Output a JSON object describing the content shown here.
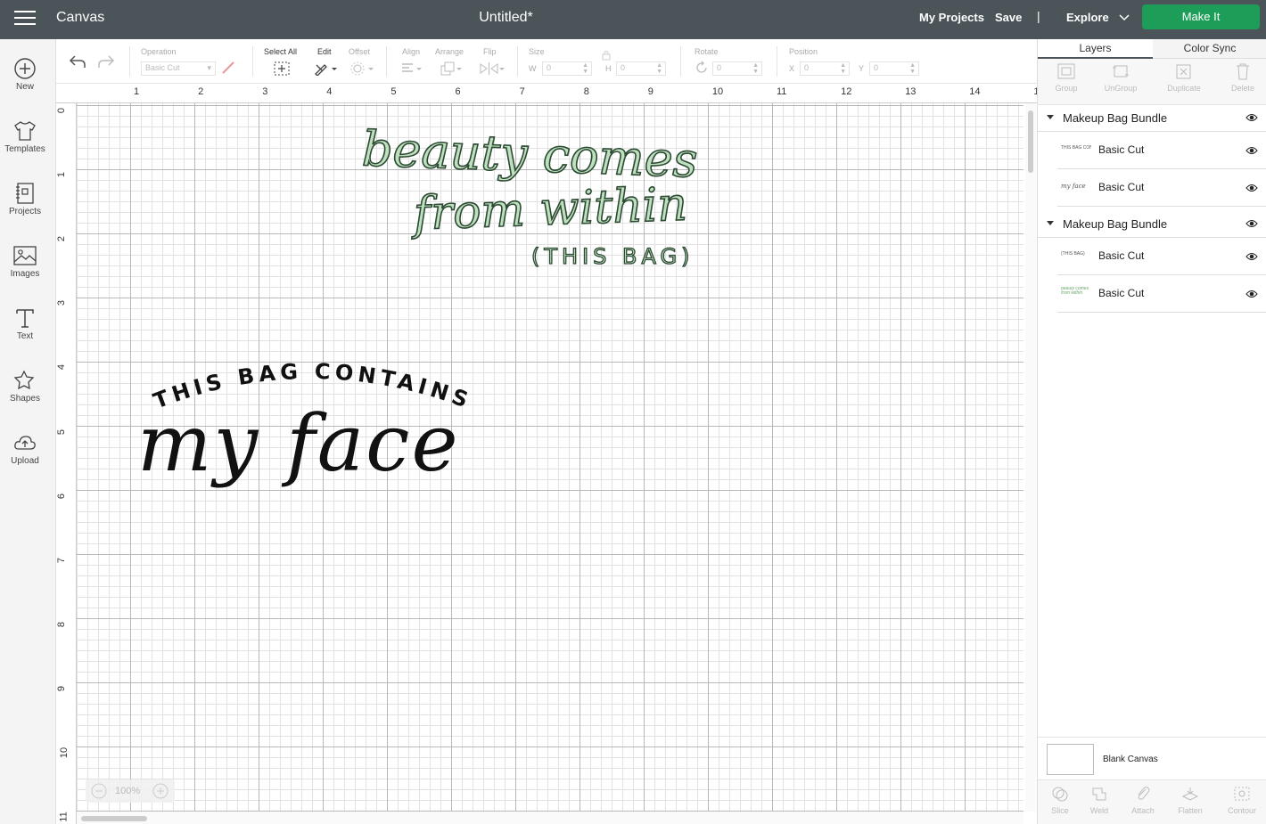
{
  "topbar": {
    "app_name": "Canvas",
    "document_title": "Untitled*",
    "my_projects": "My Projects",
    "save": "Save",
    "divider": "|",
    "explore": "Explore",
    "make_it": "Make It"
  },
  "left_nav": {
    "items": [
      {
        "label": "New",
        "icon": "plus-circle-icon"
      },
      {
        "label": "Templates",
        "icon": "tshirt-icon"
      },
      {
        "label": "Projects",
        "icon": "notebook-icon"
      },
      {
        "label": "Images",
        "icon": "image-icon"
      },
      {
        "label": "Text",
        "icon": "text-t-icon"
      },
      {
        "label": "Shapes",
        "icon": "shapes-icon"
      },
      {
        "label": "Upload",
        "icon": "cloud-upload-icon"
      }
    ]
  },
  "toolbar": {
    "operation_label": "Operation",
    "operation_value": "Basic Cut",
    "select_all": "Select All",
    "edit": "Edit",
    "offset": "Offset",
    "align": "Align",
    "arrange": "Arrange",
    "flip": "Flip",
    "size": "Size",
    "w_label": "W",
    "w_value": "0",
    "h_label": "H",
    "h_value": "0",
    "rotate": "Rotate",
    "rotate_value": "0",
    "position": "Position",
    "x_label": "X",
    "x_value": "0",
    "y_label": "Y",
    "y_value": "0"
  },
  "rulers": {
    "top": [
      "1",
      "2",
      "3",
      "4",
      "5",
      "6",
      "7",
      "8",
      "9",
      "10",
      "11",
      "12",
      "13",
      "14",
      "1"
    ],
    "left": [
      "0",
      "1",
      "2",
      "3",
      "4",
      "5",
      "6",
      "7",
      "8",
      "9",
      "10",
      "11"
    ]
  },
  "canvas": {
    "zoom": "100%",
    "design1": {
      "line1": "beauty comes",
      "line2": "from within",
      "line3": "(THIS BAG)"
    },
    "design2": {
      "arc_text": "THIS BAG CONTAINS",
      "script": "my face"
    }
  },
  "right_panel": {
    "tabs": [
      "Layers",
      "Color Sync"
    ],
    "tools": [
      "Group",
      "UnGroup",
      "Duplicate",
      "Delete"
    ],
    "groups": [
      {
        "title": "Makeup Bag Bundle",
        "layers": [
          {
            "name": "Basic Cut",
            "thumb": "THIS BAG CONTAINS"
          },
          {
            "name": "Basic Cut",
            "thumb": "my face"
          }
        ]
      },
      {
        "title": "Makeup Bag Bundle",
        "layers": [
          {
            "name": "Basic Cut",
            "thumb": "(THIS BAG)"
          },
          {
            "name": "Basic Cut",
            "thumb": "beauty comes from within"
          }
        ]
      }
    ],
    "blank_canvas": "Blank Canvas",
    "bottom_tools": [
      "Slice",
      "Weld",
      "Attach",
      "Flatten",
      "Contour"
    ]
  },
  "colors": {
    "topbar": "#4a5459",
    "make_it": "#1c9e58",
    "text_fill_green": "#bfe0bf",
    "text_outline_green": "#2c4a33"
  }
}
